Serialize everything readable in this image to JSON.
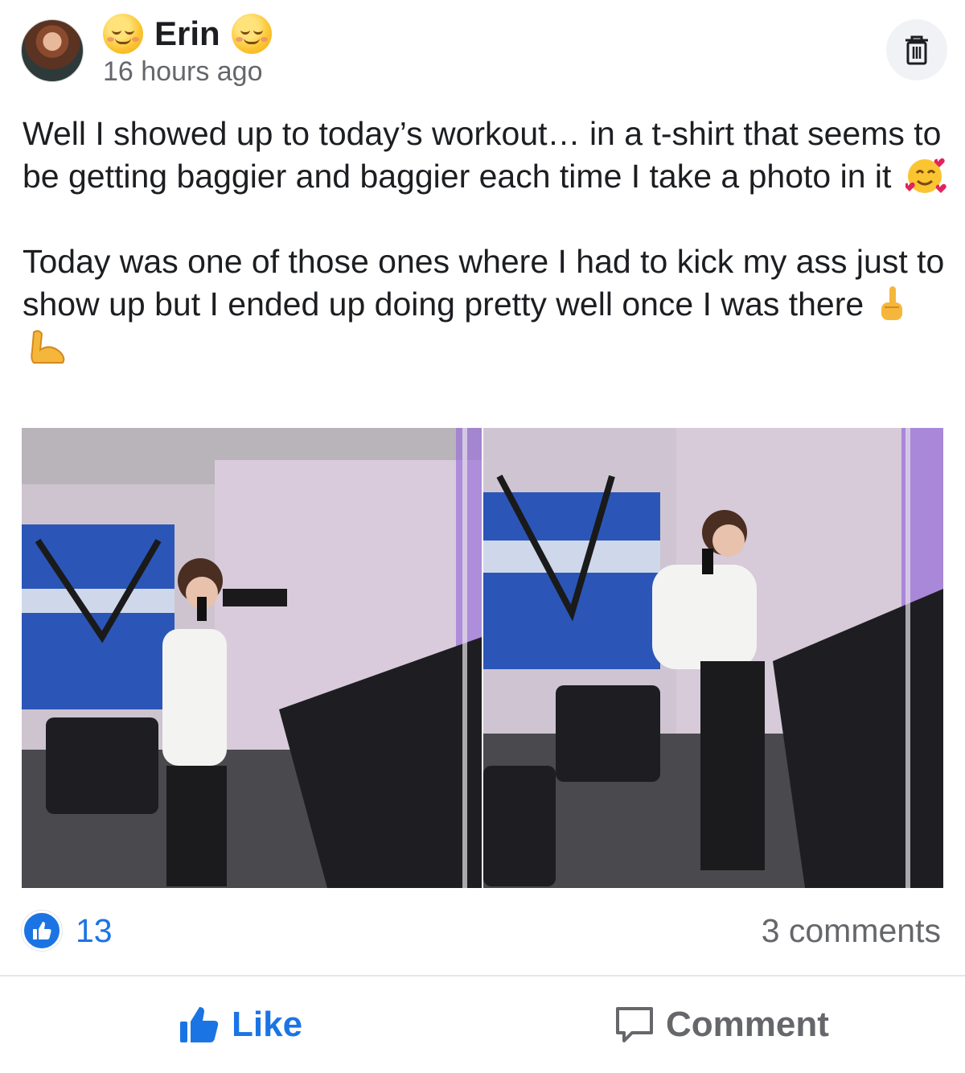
{
  "post": {
    "author": "Erin",
    "name_emoji_left": "smiling-face-emoji",
    "name_emoji_right": "smiling-face-emoji",
    "timestamp": "16 hours ago",
    "paragraphs": [
      "Well I showed up to today’s workout… in a t-shirt that seems to be getting baggier and baggier each time I take a photo in it",
      "Today was one of those ones where I had to kick my ass just to show up but I ended up doing pretty well once I was there"
    ],
    "paragraph_emojis": [
      [
        "smiling-face-with-hearts-emoji"
      ],
      [
        "middle-finger-emoji",
        "flexed-biceps-emoji"
      ]
    ],
    "photos": [
      {
        "alt_icon": "gym-mirror-selfie-photo"
      },
      {
        "alt_icon": "gym-mirror-selfie-photo"
      }
    ]
  },
  "stats": {
    "like_count": "13",
    "comments": "3 comments"
  },
  "actions": {
    "like_label": "Like",
    "comment_label": "Comment"
  },
  "icons": {
    "trash": "trash-icon",
    "like_badge": "thumbs-up-icon",
    "like_action": "thumbs-up-icon",
    "comment_action": "comment-bubble-icon"
  },
  "colors": {
    "accent": "#1b74e4",
    "muted": "#65676b",
    "text": "#1c1e21"
  }
}
